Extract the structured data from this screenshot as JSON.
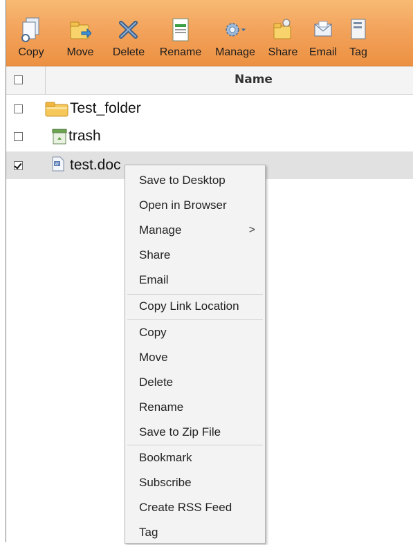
{
  "toolbar": {
    "buttons": [
      {
        "label": "Copy",
        "icon": "copy-icon"
      },
      {
        "label": "Move",
        "icon": "move-icon"
      },
      {
        "label": "Delete",
        "icon": "delete-icon"
      },
      {
        "label": "Rename",
        "icon": "rename-icon"
      },
      {
        "label": "Manage",
        "icon": "gear-icon"
      },
      {
        "label": "Share",
        "icon": "share-icon"
      },
      {
        "label": "Email",
        "icon": "email-icon"
      },
      {
        "label": "Tag",
        "icon": "tag-icon"
      }
    ],
    "colors": {
      "background": "#f3a35c"
    }
  },
  "table": {
    "header": {
      "name": "Name",
      "select_all_checked": false
    },
    "rows": [
      {
        "name": "Test_folder",
        "type": "folder",
        "checked": false
      },
      {
        "name": "trash",
        "type": "trash",
        "checked": false
      },
      {
        "name": "test.doc",
        "type": "doc",
        "checked": true
      }
    ]
  },
  "context_menu": {
    "items": [
      {
        "label": "Save to Desktop"
      },
      {
        "label": "Open in Browser"
      },
      {
        "label": "Manage",
        "submenu": true,
        "arrow": ">"
      },
      {
        "label": "Share"
      },
      {
        "label": "Email"
      },
      {
        "label": "Copy Link Location"
      },
      {
        "label": "Copy"
      },
      {
        "label": "Move"
      },
      {
        "label": "Delete"
      },
      {
        "label": "Rename"
      },
      {
        "label": "Save to Zip File"
      },
      {
        "label": "Bookmark"
      },
      {
        "label": "Subscribe"
      },
      {
        "label": "Create RSS Feed"
      },
      {
        "label": "Tag"
      }
    ]
  }
}
